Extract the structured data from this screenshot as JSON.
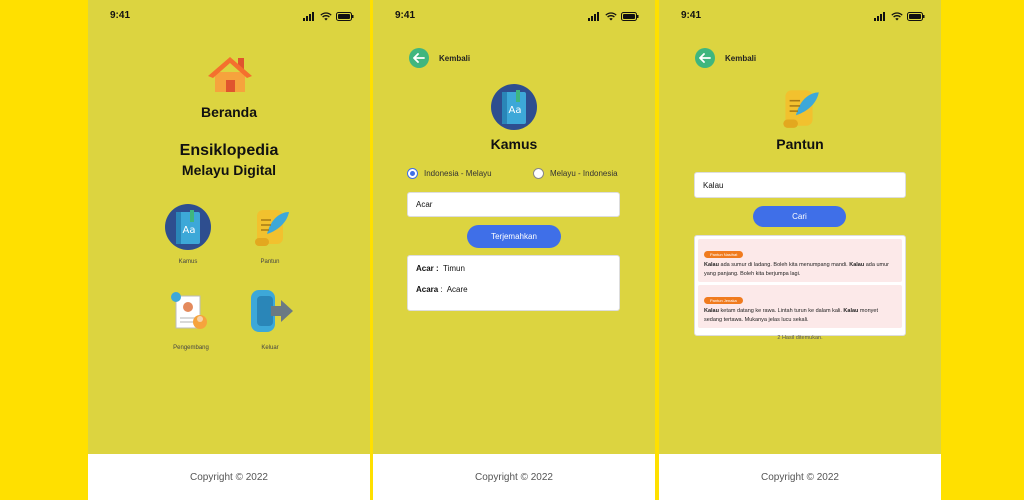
{
  "status": {
    "time": "9:41"
  },
  "footer": {
    "text": "Copyright © 2022"
  },
  "home": {
    "page_title": "Beranda",
    "app_title_line1": "Ensiklopedia",
    "app_title_line2": "Melayu Digital",
    "menu": [
      {
        "label": "Kamus",
        "icon": "dictionary-book-icon"
      },
      {
        "label": "Pantun",
        "icon": "scroll-quill-icon"
      },
      {
        "label": "Pengembang",
        "icon": "developer-profile-icon"
      },
      {
        "label": "Keluar",
        "icon": "exit-door-icon"
      }
    ]
  },
  "kamus": {
    "back_label": "Kembali",
    "title": "Kamus",
    "radio_options": [
      {
        "label": "Indonesia - Melayu",
        "selected": true
      },
      {
        "label": "Melayu - Indonesia",
        "selected": false
      }
    ],
    "input_value": "Acar",
    "button_label": "Terjemahkan",
    "results": [
      {
        "term": "Acar",
        "sep": " :",
        "meaning": "Timun"
      },
      {
        "term": "Acara",
        "sep": " :",
        "meaning": "Acare"
      }
    ]
  },
  "pantun": {
    "back_label": "Kembali",
    "title": "Pantun",
    "input_value": "Kalau",
    "button_label": "Cari",
    "results": [
      {
        "badge": "Pantun Nasihat",
        "line1_bold": "Kalau",
        "line1_rest": " ada sumur di ladang. Boleh kita menumpang mandi. ",
        "line2_bold": "Kalau",
        "line2_rest": " ada umur yang panjang. Boleh kita berjumpa lagi."
      },
      {
        "badge": "Pantun Jenaka",
        "line1_bold": "Kalau",
        "line1_rest": " ketam datang ke rawa. Lintah turun ke dalam kali. ",
        "line2_bold": "Kalau",
        "line2_rest": " monyet sedang tertawa. Mukanya jelas lucu sekali."
      }
    ],
    "result_count": "2 Hasil ditemukan."
  },
  "colors": {
    "background": "#FFE000",
    "screen": "#DCD440",
    "accent_blue": "#3F6FE8",
    "back_green": "#3FB67E",
    "badge_orange": "#F07B1E"
  }
}
